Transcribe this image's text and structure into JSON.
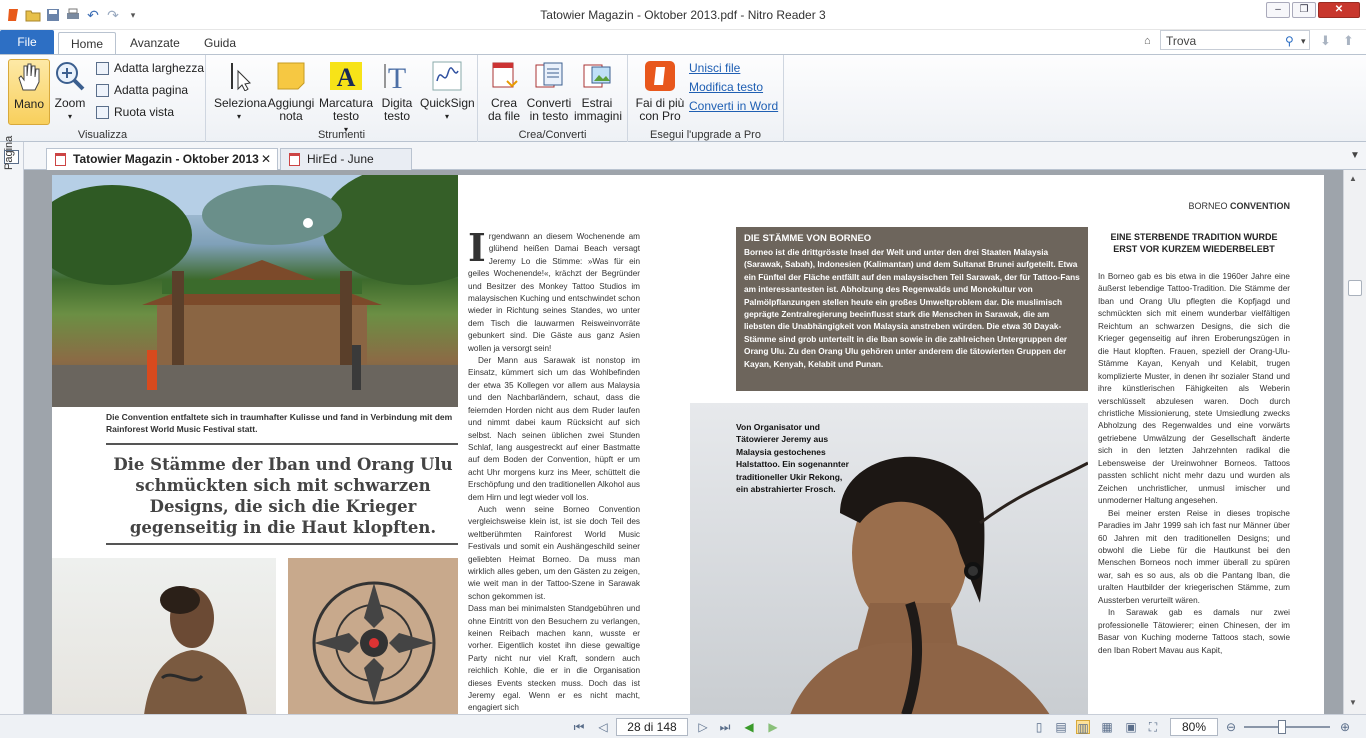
{
  "window": {
    "title": "Tatowier Magazin - Oktober 2013.pdf - Nitro Reader 3"
  },
  "menu": {
    "file": "File",
    "tabs": [
      "Home",
      "Avanzate",
      "Guida"
    ]
  },
  "search": {
    "value": "Trova"
  },
  "ribbon": {
    "visualizza": {
      "label": "Visualizza",
      "mano": "Mano",
      "zoom": "Zoom",
      "adatta_larghezza": "Adatta larghezza",
      "adatta_pagina": "Adatta pagina",
      "ruota_vista": "Ruota vista"
    },
    "strumenti": {
      "label": "Strumenti",
      "seleziona": "Seleziona",
      "aggiungi_nota": "Aggiungi nota",
      "marcatura_testo": "Marcatura testo",
      "digita_testo": "Digita testo",
      "quicksign": "QuickSign"
    },
    "crea": {
      "label": "Crea/Converti",
      "crea_da_file": "Crea da file",
      "converti_in_testo": "Converti in testo",
      "estrai_immagini": "Estrai immagini"
    },
    "upgrade": {
      "label": "Esegui l'upgrade a Pro",
      "fai_di_piu": "Fai di più con Pro",
      "unisci": "Unisci file",
      "modifica": "Modifica testo",
      "converti_word": "Converti in Word"
    }
  },
  "doctabs": [
    "Tatowier Magazin - Oktober 2013",
    "HirEd - June 2013"
  ],
  "sidepanel": {
    "label": "Pagina"
  },
  "article": {
    "caption1": "Die Convention entfaltete sich in traumhafter Kulisse und fand in Verbindung mit dem Rainforest World Music Festival statt.",
    "pullquote": "Die Stämme der Iban und Orang Ulu schmückten sich mit schwarzen Designs, die sich die Krieger gegenseitig in die Haut klopften.",
    "dropcap": "I",
    "col1": "rgendwann an diesem Wochenende am glühend heißen Damai Beach versagt Jeremy Lo die Stimme: »Was für ein geiles Wochenende!«, krächzt der Begründer und Besitzer des Monkey Tattoo Studios im malaysischen Kuching und entschwindet schon wieder in Richtung seines Standes, wo unter dem Tisch die lauwarmen Reisweinvorräte gebunkert sind. Die Gäste aus ganz Asien wollen ja versorgt sein!",
    "col1b": "Der Mann aus Sarawak ist nonstop im Einsatz, kümmert sich um das Wohlbefinden der etwa 35 Kollegen vor allem aus Malaysia und den Nachbarländern, schaut, dass die feiernden Horden nicht aus dem Ruder laufen und nimmt dabei kaum Rücksicht auf sich selbst. Nach seinen üblichen zwei Stunden Schlaf, lang ausgestreckt auf einer Bastmatte auf dem Boden der Convention, hüpft er um acht Uhr morgens kurz ins Meer, schüttelt die Erschöpfung und den traditionellen Alkohol aus dem Hirn und legt wieder voll los.",
    "col1c": "Auch wenn seine Borneo Convention vergleichsweise klein ist, ist sie doch Teil des weltberühmten Rainforest World Music Festivals und somit ein Aushängeschild seiner geliebten Heimat Borneo. Da muss man wirklich alles geben, um den Gästen zu zeigen, wie weit man in der Tattoo-Szene in Sarawak schon gekommen ist.",
    "col1d": "Dass man bei minimalsten Standgebühren und ohne Eintritt von den Besuchern zu verlangen, keinen Reibach machen kann, wusste er vorher. Eigentlich kostet ihn diese gewaltige Party nicht nur viel Kraft, sondern auch reichlich Kohle, die er in die Organisation dieses Events stecken muss. Doch das ist Jeremy egal. Wenn er es nicht macht, engagiert sich",
    "header_pre": "BORNEO",
    "header_bold": "CONVENTION",
    "box_title": "DIE STÄMME VON BORNEO",
    "box_text": "Borneo ist die drittgrösste Insel der Welt und unter den drei Staaten Malaysia (Sarawak, Sabah), Indonesien (Kalimantan) und dem Sultanat Brunei aufgeteilt. Etwa ein Fünftel der Fläche entfällt auf den malaysischen Teil Sarawak, der für Tattoo-Fans am interessantesten ist. Abholzung des Regenwalds und Monokultur von Palmölpflanzungen stellen heute ein großes Umweltproblem dar. Die muslimisch geprägte Zentralregierung beeinflusst stark die Menschen in Sarawak, die am liebsten die Unabhängigkeit von Malaysia anstreben würden. Die etwa 30 Dayak-Stämme sind grob unterteilt in die Iban sowie in die zahlreichen Untergruppen der Orang Ulu. Zu den Orang Ulu gehören unter anderem die tätowierten Gruppen der Kayan, Kenyah, Kelabit und Punan.",
    "caption2": "Von Organisator und Tätowierer Jeremy aus Malaysia gestochenes Halstattoo. Ein sogenannter traditioneller Ukir Rekong, ein abstrahierter Frosch.",
    "right_head": "EINE STERBENDE TRADITION WURDE ERST VOR KURZEM WIEDERBELEBT",
    "right_p1": "In Borneo gab es bis etwa in die 1960er Jahre eine äußerst lebendige Tattoo-Tradition. Die Stämme der Iban und Orang Ulu pflegten die Kopfjagd und schmückten sich mit einem wunderbar vielfältigen Reichtum an schwarzen Designs, die sich die Krieger gegenseitig auf ihren Eroberungszügen in die Haut klopften. Frauen, speziell der Orang-Ulu-Stämme Kayan, Kenyah und Kelabit, trugen komplizierte Muster, in denen ihr sozialer Stand und ihre künstlerischen Fähigkeiten als Weberin verschlüsselt abzulesen waren. Doch durch christliche Missionierung, stete Umsiedlung zwecks Abholzung des Regenwaldes und eine vorwärts getriebene Umwälzung der Gesellschaft änderte sich in den letzten Jahrzehnten radikal die Lebensweise der Ureinwohner Borneos. Tattoos passten schlicht nicht mehr dazu und wurden als Zeichen unchristlicher, unmusl imischer und unmoderner Haltung angesehen.",
    "right_p2": "Bei meiner ersten Reise in dieses tropische Paradies im Jahr 1999 sah ich fast nur Männer über 60 Jahren mit den traditionellen Designs; und obwohl die Liebe für die Hautkunst bei den Menschen Borneos noch immer überall zu spüren war, sah es so aus, als ob die Pantang Iban, die uralten Hautbilder der kriegerischen Stämme, zum Aussterben verurteilt wären.",
    "right_p3": "In Sarawak gab es damals nur zwei professionelle Tätowierer; einen Chinesen, der im Basar von Kuching moderne Tattoos stach, sowie den Iban Robert Mavau aus Kapit,"
  },
  "status": {
    "page": "28 di 148",
    "zoom": "80%"
  }
}
